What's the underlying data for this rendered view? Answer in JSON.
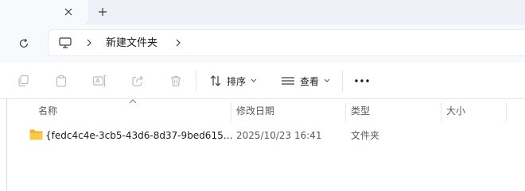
{
  "tab": {
    "close_glyph": "✕",
    "new_tab_glyph": "+"
  },
  "address": {
    "crumbs": [
      "新建文件夹"
    ]
  },
  "toolbar": {
    "sort_label": "排序",
    "view_label": "查看",
    "more_glyph": "•••"
  },
  "columns": {
    "name": "名称",
    "modified": "修改日期",
    "type": "类型",
    "size": "大小"
  },
  "files": [
    {
      "name": "{fedc4c4e-3cb5-43d6-8d37-9bed615…",
      "modified": "2025/10/23 16:41",
      "type": "文件夹",
      "size": ""
    }
  ],
  "colors": {
    "tab_strip": "#eef1f7",
    "nav_background": "#f7f9fc",
    "folder_yellow": "#f8c94a",
    "disabled_icon": "#b9bec6",
    "secondary_text": "#5a5a5a"
  }
}
